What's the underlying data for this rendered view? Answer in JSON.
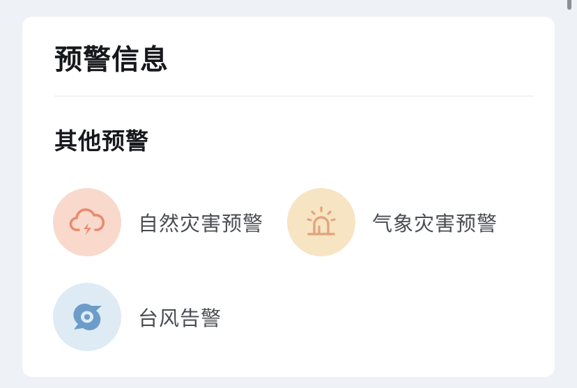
{
  "card": {
    "title": "预警信息",
    "section_title": "其他预警"
  },
  "alerts": [
    {
      "label": "自然灾害预警",
      "icon": "cloud-lightning-icon",
      "bg_color": "#f9d9cc",
      "icon_color": "#e98a71"
    },
    {
      "label": "气象灾害预警",
      "icon": "siren-icon",
      "bg_color": "#f7e4c3",
      "icon_color": "#e2a57e"
    },
    {
      "label": "台风告警",
      "icon": "typhoon-icon",
      "bg_color": "#deebf5",
      "icon_color": "#6d9cc9"
    }
  ]
}
